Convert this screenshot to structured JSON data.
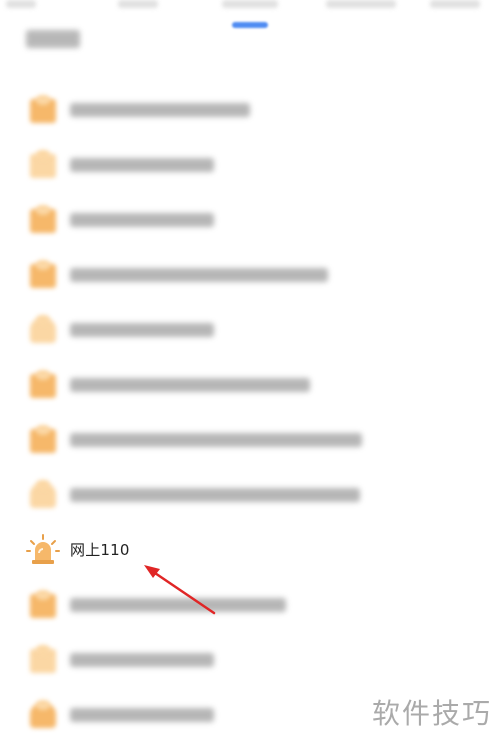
{
  "tabs": {
    "active_index": 2,
    "accent_color": "#4f8bf2"
  },
  "section": {
    "title": ""
  },
  "services": [
    {
      "label": "",
      "icon": "person-folder-icon",
      "blurred": true
    },
    {
      "label": "",
      "icon": "folder-icon",
      "blurred": true
    },
    {
      "label": "",
      "icon": "document-icon",
      "blurred": true
    },
    {
      "label": "",
      "icon": "folder-icon",
      "blurred": true
    },
    {
      "label": "",
      "icon": "badge-icon",
      "blurred": true
    },
    {
      "label": "",
      "icon": "folder-icon",
      "blurred": true
    },
    {
      "label": "",
      "icon": "document-icon",
      "blurred": true
    },
    {
      "label": "",
      "icon": "person-icon",
      "blurred": true
    },
    {
      "label": "网上110",
      "icon": "police-alarm-icon",
      "blurred": false
    },
    {
      "label": "",
      "icon": "folder-icon",
      "blurred": true
    },
    {
      "label": "",
      "icon": "folder-icon",
      "blurred": true
    },
    {
      "label": "",
      "icon": "person-icon",
      "blurred": true
    }
  ],
  "colors": {
    "icon_orange": "#f6b86a",
    "icon_orange_light": "#fbd7a4",
    "annotation_red": "#e02626",
    "text_primary": "#222222"
  },
  "watermark": "软件技巧"
}
